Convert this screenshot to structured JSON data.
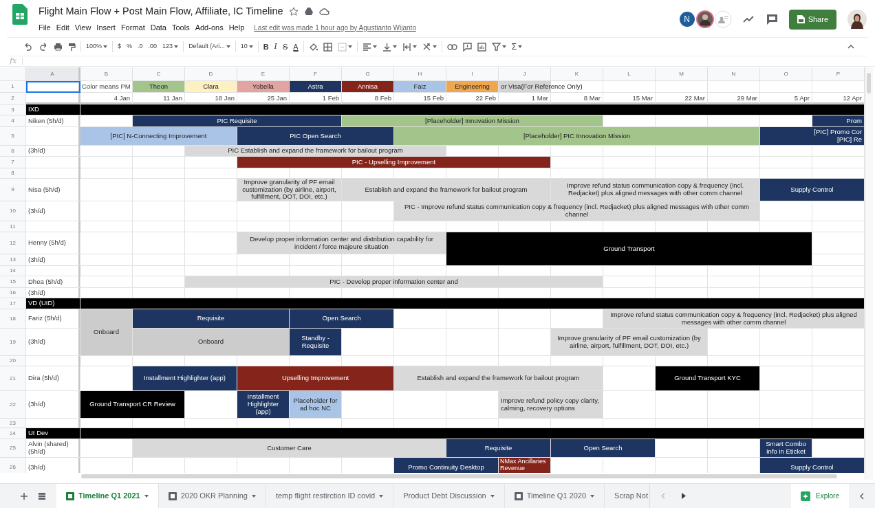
{
  "document": {
    "title": "Flight Main Flow + Post Main Flow, Affiliate, IC Timeline",
    "last_edit": "Last edit was made 1 hour ago by Agustianto Wijanto"
  },
  "menu": [
    "File",
    "Edit",
    "View",
    "Insert",
    "Format",
    "Data",
    "Tools",
    "Add-ons",
    "Help"
  ],
  "collaborators": [
    {
      "initial": "N",
      "color": "#1f5f99"
    }
  ],
  "share_button": "Share",
  "toolbar": [
    "100%",
    "$",
    "%",
    ".0",
    ".00",
    "123",
    "Default (Ari...",
    "10",
    "B",
    "I",
    "S",
    "A",
    "Σ"
  ],
  "formula_bar": {
    "label": "fx"
  },
  "columns": [
    "A",
    "B",
    "C",
    "D",
    "E",
    "F",
    "G",
    "H",
    "I",
    "J",
    "K",
    "L",
    "M",
    "N",
    "O",
    "P"
  ],
  "rows": [
    {
      "number": "1",
      "cells": [
        {
          "selected": true
        },
        {
          "text": "Color means PM"
        },
        {
          "text": "Theon",
          "color": "#a3c48b"
        },
        {
          "text": "Clara",
          "color": "#fdf1c2"
        },
        {
          "text": "Yobella",
          "color": "#e3a3a3"
        },
        {
          "text": "Astra",
          "color": "#1d3560"
        },
        {
          "text": "Annisa",
          "color": "#85241a"
        },
        {
          "text": "Faiz",
          "color": "#a9c4e6"
        },
        {
          "text": "Engineering",
          "color": "#f0a64f"
        },
        {
          "text": "or Visa(For Reference Only)",
          "color": "#d4d4d4"
        }
      ]
    },
    {
      "number": "2",
      "cells": [
        {
          "text": "4 Jan"
        },
        {
          "text": "11 Jan"
        },
        {
          "text": "18 Jan"
        },
        {
          "text": "25 Jan"
        },
        {
          "text": "1 Feb"
        },
        {
          "text": "8 Feb"
        },
        {
          "text": "15 Feb"
        },
        {
          "text": "22 Feb"
        },
        {
          "text": "1 Mar"
        },
        {
          "text": "8 Mar"
        },
        {
          "text": "15 Mar"
        },
        {
          "text": "22 Mar"
        },
        {
          "text": "29 Mar"
        },
        {
          "text": "5 Apr"
        },
        {
          "text": "12 Apr"
        }
      ]
    },
    {
      "number": "3",
      "cells": [
        {
          "text": "IXD",
          "color": "#000000"
        },
        {
          "color": "#000000"
        }
      ]
    },
    {
      "number": "4",
      "cells": [
        {
          "text": "Niken (5h/d)"
        },
        {
          "text": "PIC Requisite",
          "color": "#1d3560"
        },
        {
          "text": "[Placeholder] Innovation Mission",
          "color": "#a3c48b"
        },
        {
          "text": "Prom",
          "color": "#1d3560"
        }
      ]
    },
    {
      "number": "5",
      "cells": [
        {
          "text": "[PIC] N-Connecting Improvement",
          "color": "#a9c4e6"
        },
        {
          "text": "PIC Open Search",
          "color": "#1d3560"
        },
        {
          "text": "[Placeholder] PIC Innovation Mission",
          "color": "#a3c48b"
        },
        {
          "text": "[PIC] Promo Cor\n[PIC] Re",
          "color": "#1d3560"
        }
      ]
    },
    {
      "number": "6",
      "cells": [
        {
          "text": "(3h/d)"
        },
        {
          "text": "PIC Establish and expand the framework for bailout program",
          "color": "#d9d9d9"
        }
      ]
    },
    {
      "number": "7",
      "cells": [
        {
          "text": "PIC - Upselling Improvement",
          "color": "#85241a"
        }
      ]
    },
    {
      "number": "8",
      "cells": []
    },
    {
      "number": "9",
      "cells": [
        {
          "text": "Nisa (5h/d)"
        },
        {
          "text": "Improve granularity of PF email customization (by airline, airport, fulfillment, DOT, DOI, etc.)",
          "color": "#d9d9d9"
        },
        {
          "text": "Establish and expand the framework for bailout program",
          "color": "#d9d9d9"
        },
        {
          "text": "Improve refund status communication copy & frequency (incl. Redjacket) plus aligned messages with other comm channel",
          "color": "#d9d9d9"
        },
        {
          "text": "Supply Control",
          "color": "#1d3560"
        }
      ]
    },
    {
      "number": "10",
      "cells": [
        {
          "text": "(3h/d)"
        },
        {
          "text": "PIC - Improve refund status communication copy & frequency (incl. Redjacket) plus aligned messages with other comm channel",
          "color": "#d9d9d9"
        }
      ]
    },
    {
      "number": "11",
      "cells": []
    },
    {
      "number": "12",
      "cells": [
        {
          "text": "Henny (5h/d)"
        },
        {
          "text": "Develop proper information center and distribution capability for incident / force majeure situation",
          "color": "#d9d9d9"
        },
        {
          "text": "Ground Transport",
          "color": "#000000"
        }
      ]
    },
    {
      "number": "13",
      "cells": [
        {
          "text": "(3h/d)"
        }
      ]
    },
    {
      "number": "14",
      "cells": []
    },
    {
      "number": "15",
      "cells": [
        {
          "text": "Dhea (5h/d)"
        },
        {
          "text": "PIC - Develop proper information center and",
          "color": "#d9d9d9"
        }
      ]
    },
    {
      "number": "16",
      "cells": [
        {
          "text": "(3h/d)"
        }
      ]
    },
    {
      "number": "17",
      "cells": [
        {
          "text": "VD (UID)",
          "color": "#000000"
        },
        {
          "color": "#000000"
        }
      ]
    },
    {
      "number": "18",
      "cells": [
        {
          "text": "Fariz (5h/d)"
        },
        {
          "text": "Onboard",
          "color": "#cccccc"
        },
        {
          "text": "Requisite",
          "color": "#1d3560"
        },
        {
          "text": "Open Search",
          "color": "#1d3560"
        },
        {
          "text": "Improve refund status communication copy & frequency (incl. Redjacket) plus aligned messages with other comm channel",
          "color": "#d9d9d9"
        }
      ]
    },
    {
      "number": "19",
      "cells": [
        {
          "text": "(3h/d)"
        },
        {
          "text": "Onboard",
          "color": "#cccccc"
        },
        {
          "text": "Standby - Requisite",
          "color": "#1d3560"
        },
        {
          "text": "Improve granularity of PF email customization (by airline, airport, fulfillment, DOT, DOI, etc.)",
          "color": "#d9d9d9"
        }
      ]
    },
    {
      "number": "20",
      "cells": []
    },
    {
      "number": "21",
      "cells": [
        {
          "text": "Dira (5h/d)"
        },
        {
          "text": "Installment Highlighter (app)",
          "color": "#1d3560"
        },
        {
          "text": "Upselling Improvement",
          "color": "#85241a"
        },
        {
          "text": "Establish and expand the framework for bailout program",
          "color": "#d9d9d9"
        },
        {
          "text": "Ground Transport KYC",
          "color": "#000000"
        }
      ]
    },
    {
      "number": "22",
      "cells": [
        {
          "text": "(3h/d)"
        },
        {
          "text": "Ground Transport CR Review",
          "color": "#000000"
        },
        {
          "text": "Installment Highlighter (app)",
          "color": "#1d3560"
        },
        {
          "text": "Placeholder for ad hoc NC",
          "color": "#a9c4e6"
        },
        {
          "text": "Improve refund policy copy clarity, calming, recovery options",
          "color": "#d9d9d9"
        }
      ]
    },
    {
      "number": "23",
      "cells": []
    },
    {
      "number": "24",
      "cells": [
        {
          "text": "UI Dev",
          "color": "#000000"
        },
        {
          "color": "#000000"
        }
      ]
    },
    {
      "number": "25",
      "cells": [
        {
          "text": "Alvin (shared) (5h/d)"
        },
        {
          "text": "Customer Care",
          "color": "#d9d9d9"
        },
        {
          "text": "Requisite",
          "color": "#1d3560"
        },
        {
          "text": "Open Search",
          "color": "#1d3560"
        },
        {
          "text": "Smart Combo Info in Eticket",
          "color": "#1d3560"
        }
      ]
    },
    {
      "number": "26",
      "cells": [
        {
          "text": "(3h/d)"
        },
        {
          "text": "Promo Continuity Desktop",
          "color": "#1d3560"
        },
        {
          "text": "NMax Ancillaries Revenue",
          "color": "#85241a"
        },
        {
          "text": "Supply Control",
          "color": "#1d3560"
        }
      ]
    }
  ],
  "sheet_tabs": [
    {
      "label": "Timeline Q1 2021",
      "selected": true,
      "kind": "icon"
    },
    {
      "label": "2020 OKR Planning",
      "selected": false,
      "kind": "icon"
    },
    {
      "label": "temp flight restirction ID covid",
      "selected": false,
      "kind": "plain"
    },
    {
      "label": "Product Debt Discussion",
      "selected": false,
      "kind": "plain"
    },
    {
      "label": "Timeline Q1 2020",
      "selected": false,
      "kind": "icon"
    },
    {
      "label": "Scrap Not",
      "selected": false,
      "kind": "cut"
    }
  ],
  "explore_button": "Explore"
}
